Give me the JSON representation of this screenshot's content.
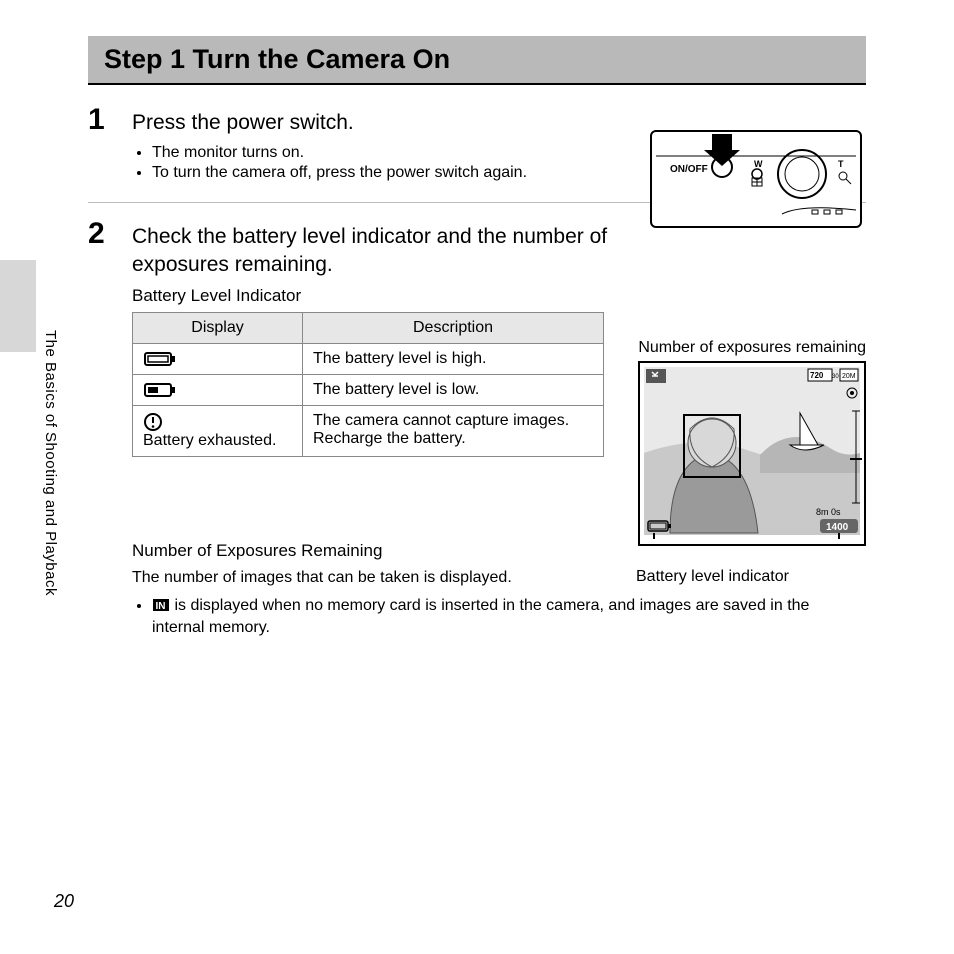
{
  "title": "Step 1 Turn the Camera On",
  "side_section": "The Basics of Shooting and Playback",
  "page_number": "20",
  "step1": {
    "num": "1",
    "heading": "Press the power switch.",
    "bullets": [
      "The monitor turns on.",
      "To turn the camera off, press the power switch again."
    ],
    "label_onoff": "ON/OFF",
    "label_w": "W",
    "label_t": "T"
  },
  "step2": {
    "num": "2",
    "heading": "Check the battery level indicator and the number of exposures remaining.",
    "batt_heading": "Battery Level Indicator",
    "table": {
      "col1": "Display",
      "col2": "Description",
      "rows": [
        {
          "display_text": "",
          "desc": "The battery level is high."
        },
        {
          "display_text": "",
          "desc": "The battery level is low."
        },
        {
          "display_text": "Battery exhausted.",
          "desc": "The camera cannot capture images. Recharge the battery."
        }
      ]
    },
    "monitor_label_top": "Number of exposures remaining",
    "monitor_label_bottom": "Battery level indicator",
    "monitor_osd": {
      "hd": "720",
      "fps": "30",
      "sz": "20M",
      "time": "8m 0s",
      "count": "1400"
    },
    "sub_heading": "Number of Exposures Remaining",
    "body": "The number of images that can be taken is displayed.",
    "bullet2": " is displayed when no memory card is inserted in the camera, and images are saved in the internal memory."
  }
}
